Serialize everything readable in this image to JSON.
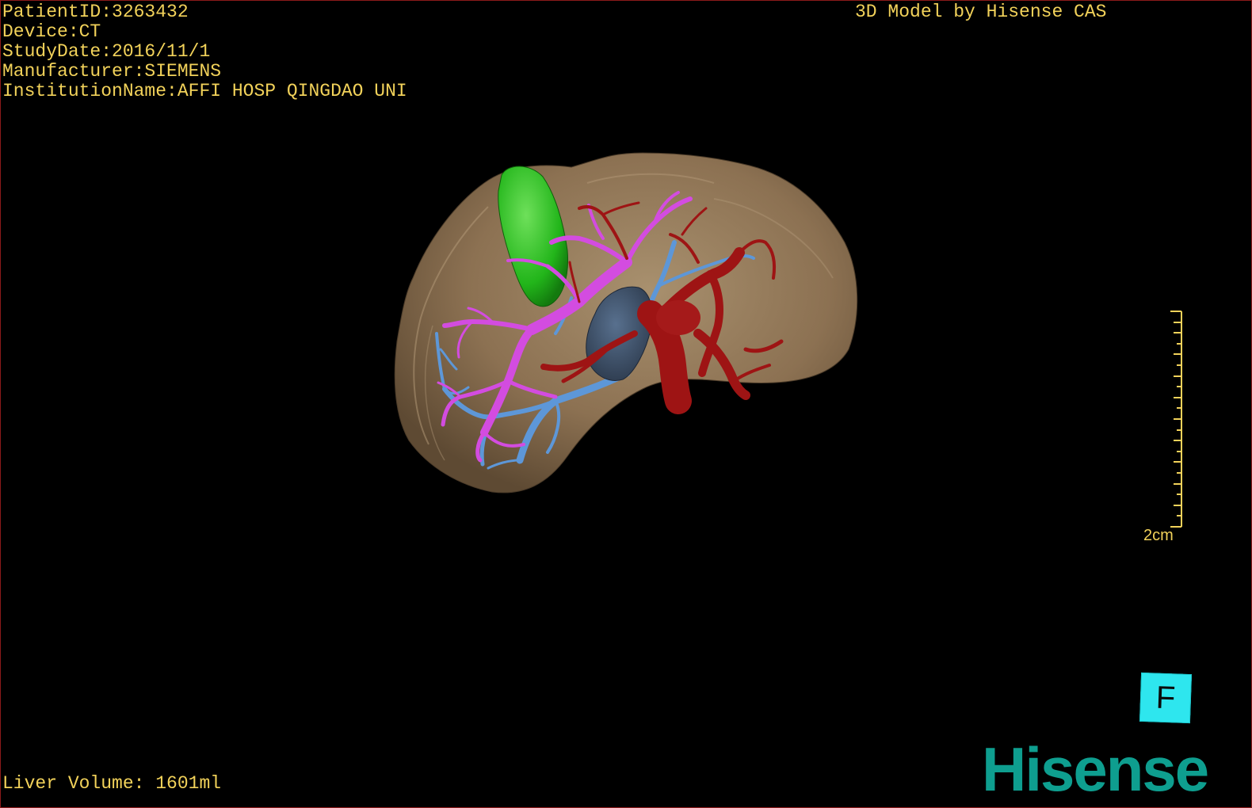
{
  "overlay": {
    "patient_id": "PatientID:3263432",
    "device": "Device:CT",
    "study_date": "StudyDate:2016/11/1",
    "manufacturer": "Manufacturer:SIEMENS",
    "institution": "InstitutionName:AFFI HOSP QINGDAO UNI",
    "model_credit": "3D Model by Hisense CAS",
    "liver_volume": "Liver Volume: 1601ml"
  },
  "scale_bar": {
    "label": "2cm"
  },
  "orientation_cube": {
    "label": "F",
    "color": "#2ee6ee"
  },
  "brand": {
    "logo_text": "Hisense",
    "color": "#0e9e8f"
  },
  "colors": {
    "overlay_text": "#f2d25a",
    "liver": "#8c7152",
    "gallbladder": "#22b51a",
    "portal_vein": "#d34ce0",
    "hepatic_vein": "#5d97d8",
    "artery": "#9e1414",
    "tumor": "#3b4d66"
  }
}
